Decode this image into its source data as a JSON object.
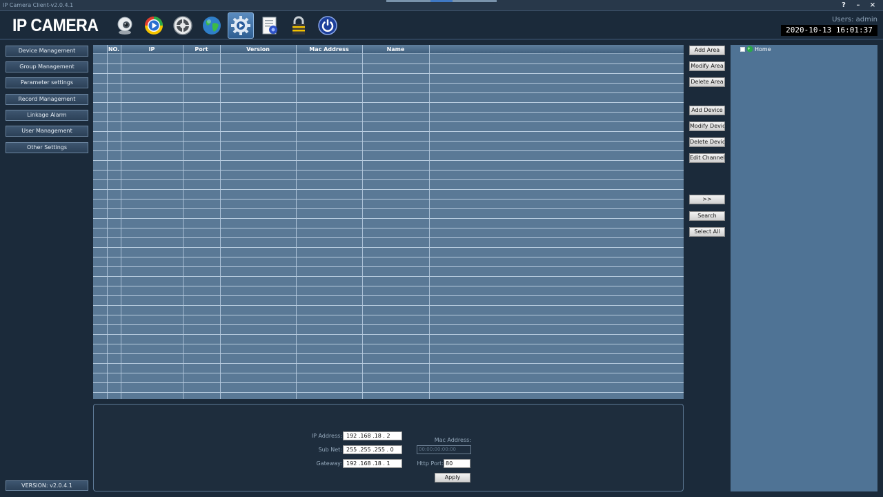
{
  "window": {
    "title": "IP Camera Client-v2.0.4.1",
    "help": "?",
    "minimize": "–",
    "close": "×"
  },
  "header": {
    "logo": "IP CAMERA",
    "users": "Users: admin",
    "datetime": "2020-10-13 16:01:37",
    "toolbar": [
      {
        "icon": "webcam-icon"
      },
      {
        "icon": "playback-icon"
      },
      {
        "icon": "ptz-control-icon"
      },
      {
        "icon": "globe-icon"
      },
      {
        "icon": "settings-gear-icon",
        "active": true
      },
      {
        "icon": "log-document-icon"
      },
      {
        "icon": "lock-icon"
      },
      {
        "icon": "power-icon"
      }
    ]
  },
  "sidebar": {
    "items": [
      {
        "label": "Device Management"
      },
      {
        "label": "Group Management"
      },
      {
        "label": "Parameter settings"
      },
      {
        "label": "Record Management"
      },
      {
        "label": "Linkage Alarm"
      },
      {
        "label": "User Management"
      },
      {
        "label": "Other Settings"
      }
    ],
    "version": "VERSION: v2.0.4.1"
  },
  "grid": {
    "columns": [
      "",
      "NO.",
      "IP",
      "Port",
      "Version",
      "Mac Address",
      "Name"
    ],
    "rows": []
  },
  "actions": {
    "add_area": "Add Area",
    "modify_area": "Modify Area",
    "delete_area": "Delete Area",
    "add_device": "Add Device",
    "modify_device": "Modify Device",
    "delete_device": "Delete Device",
    "edit_channel": "Edit Channel",
    "move": ">>",
    "search": "Search",
    "select_all": "Select All"
  },
  "tree": {
    "root": "Home"
  },
  "network": {
    "ip_label": "IP Address:",
    "ip_value": "192 .168 .18  .  2",
    "subnet_label": "Sub Net:",
    "subnet_value": "255 .255 .255 .  0",
    "gateway_label": "Gateway:",
    "gateway_value": "192 .168 .18  .  1",
    "mac_label": "Mac Address:",
    "mac_value": "00:00:00:00:00",
    "http_label": "Http Port:",
    "http_value": "80",
    "apply": "Apply"
  },
  "colors": {
    "background": "#1b2a3a",
    "grid": "#5a7996",
    "tree_panel": "#4f7395",
    "active_toolbar": "#4a7bb0"
  }
}
